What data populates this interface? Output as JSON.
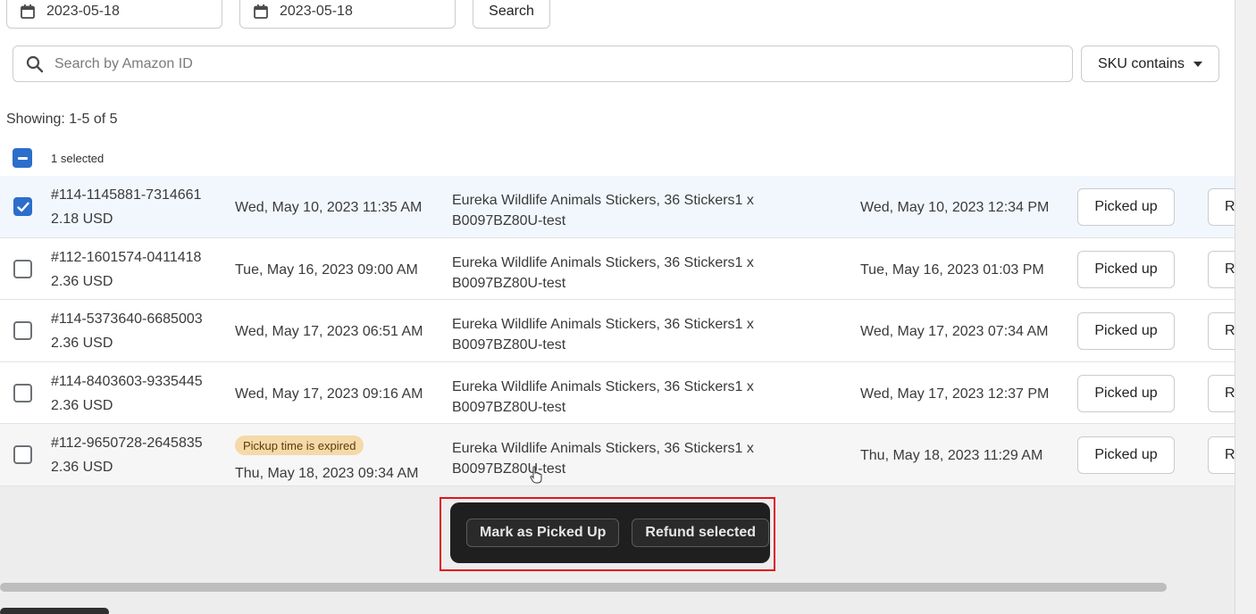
{
  "filters": {
    "start_date": "2023-05-18",
    "end_date": "2023-05-18",
    "search_label": "Search"
  },
  "search": {
    "placeholder": "Search by Amazon ID",
    "value": "",
    "sku_filter_label": "SKU contains"
  },
  "summary": {
    "showing": "Showing: 1-5 of 5",
    "selected": "1 selected"
  },
  "rows": [
    {
      "checked": true,
      "order_id": "#114-1145881-7314661",
      "amount": "2.18 USD",
      "badge": "",
      "order_date": "Wed, May 10, 2023 11:35 AM",
      "product_line1": "Eureka Wildlife Animals Stickers, 36 Stickers1 x",
      "product_line2": "B0097BZ80U-test",
      "pickup_date": "Wed, May 10, 2023 12:34 PM",
      "picked_label": "Picked up",
      "refund_label": "Re"
    },
    {
      "checked": false,
      "order_id": "#112-1601574-0411418",
      "amount": "2.36 USD",
      "badge": "",
      "order_date": "Tue, May 16, 2023 09:00 AM",
      "product_line1": "Eureka Wildlife Animals Stickers, 36 Stickers1 x",
      "product_line2": "B0097BZ80U-test",
      "pickup_date": "Tue, May 16, 2023 01:03 PM",
      "picked_label": "Picked up",
      "refund_label": "Re"
    },
    {
      "checked": false,
      "order_id": "#114-5373640-6685003",
      "amount": "2.36 USD",
      "badge": "",
      "order_date": "Wed, May 17, 2023 06:51 AM",
      "product_line1": "Eureka Wildlife Animals Stickers, 36 Stickers1 x",
      "product_line2": "B0097BZ80U-test",
      "pickup_date": "Wed, May 17, 2023 07:34 AM",
      "picked_label": "Picked up",
      "refund_label": "Re"
    },
    {
      "checked": false,
      "order_id": "#114-8403603-9335445",
      "amount": "2.36 USD",
      "badge": "",
      "order_date": "Wed, May 17, 2023 09:16 AM",
      "product_line1": "Eureka Wildlife Animals Stickers, 36 Stickers1 x",
      "product_line2": "B0097BZ80U-test",
      "pickup_date": "Wed, May 17, 2023 12:37 PM",
      "picked_label": "Picked up",
      "refund_label": "Re"
    },
    {
      "checked": false,
      "order_id": "#112-9650728-2645835",
      "amount": "2.36 USD",
      "badge": "Pickup time is expired",
      "order_date": "Thu, May 18, 2023 09:34 AM",
      "product_line1": "Eureka Wildlife Animals Stickers, 36 Stickers1 x",
      "product_line2": "B0097BZ80U-test",
      "pickup_date": "Thu, May 18, 2023 11:29 AM",
      "picked_label": "Picked up",
      "refund_label": "Re"
    }
  ],
  "bulk_actions": {
    "mark_picked_up": "Mark as Picked Up",
    "refund_selected": "Refund selected"
  },
  "colors": {
    "accent": "#2c6ecb",
    "badge_bg": "#f5d9a8",
    "highlight": "#e0141e",
    "bulk_bar_bg": "#1f1f1f"
  },
  "icons": {
    "date_field": "calendar-icon",
    "search": "search-icon",
    "sku_dropdown": "caret-down-icon",
    "checkbox": "checkmark-icon",
    "pointer": "hand-cursor-icon"
  }
}
